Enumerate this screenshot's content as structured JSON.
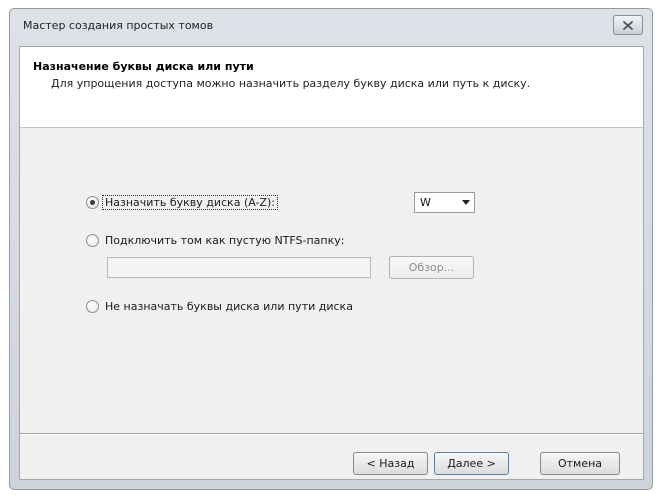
{
  "window": {
    "title": "Мастер создания простых томов"
  },
  "header": {
    "title": "Назначение буквы диска или пути",
    "description": "Для упрощения доступа можно назначить разделу букву диска или путь к диску."
  },
  "options": {
    "assign_letter": {
      "label": "Назначить букву диска (A-Z):",
      "selected": true
    },
    "mount_folder": {
      "label": "Подключить том как пустую NTFS-папку:",
      "selected": false
    },
    "no_letter": {
      "label": "Не назначать буквы диска или пути диска",
      "selected": false
    }
  },
  "drive_letter_select": {
    "value": "W"
  },
  "folder_path_input": {
    "value": ""
  },
  "browse_button": {
    "label": "Обзор..."
  },
  "nav": {
    "back_label": "< Назад",
    "next_label": "Далее >",
    "cancel_label": "Отмена"
  }
}
